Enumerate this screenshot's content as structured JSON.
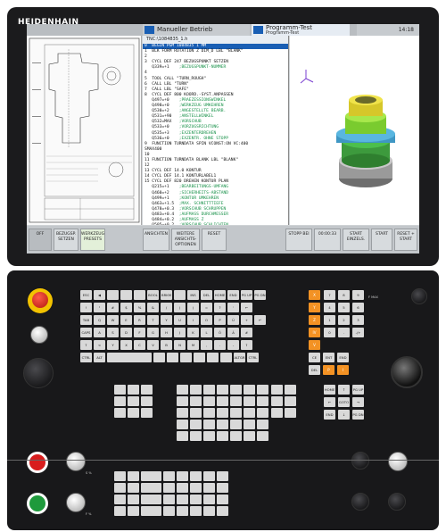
{
  "brand": {
    "logo": "HEIDENHAIN"
  },
  "screen": {
    "mode_left": "Manueller Betrieb",
    "mode_right": "Programm-Test",
    "mode_right_sub": "Programm-Test",
    "clock": "14:18",
    "program_header": "TNC:\\1084835_1.h",
    "program_lines": [
      {
        "t": "0  BEGIN PGM 1084835 1 MM",
        "sel": true
      },
      {
        "t": "1  BLK FORM ROTATION Z DIM_D LBL \"BLANK\""
      },
      {
        "t": "2"
      },
      {
        "t": "3  CYCL DEF 247 BEZUGSPUNKT SETZEN"
      },
      {
        "t": "   Q339=+1    ;BEZUGSPUNKT-NUMMER"
      },
      {
        "t": "4"
      },
      {
        "t": "5  TOOL CALL \"TURN_ROUGH\""
      },
      {
        "t": "6  CALL LBL \"TURN\""
      },
      {
        "t": "7  CALL LBL \"SAFE\""
      },
      {
        "t": "8  CYCL DEF 800 KOORD.-SYST.ANPASSEN"
      },
      {
        "t": "   Q497=+0    ;PRAEZESSIONSWINKEL"
      },
      {
        "t": "   Q498=+0    ;WERKZEUG UMKEHREN"
      },
      {
        "t": "   Q530=+2    ;ANGESTELLTE BEARB."
      },
      {
        "t": "   Q531=+90   ;ANSTELLWINKEL"
      },
      {
        "t": "   Q532=MAX   ;VORSCHUB"
      },
      {
        "t": "   Q533=+0    ;VORZUGSRICHTUNG"
      },
      {
        "t": "   Q535=+3    ;EXZENTERDREHEN"
      },
      {
        "t": "   Q536=+0    ;EXZENTR. OHNE STOPP"
      },
      {
        "t": "9  FUNCTION TURNDATA SPIN VCONST:ON VC:400"
      },
      {
        "t": "SMAX400"
      },
      {
        "t": "10"
      },
      {
        "t": "11 FUNCTION TURNDATA BLANK LBL \"BLANK\""
      },
      {
        "t": "12"
      },
      {
        "t": "13 CYCL DEF 14.0 KONTUR"
      },
      {
        "t": "14 CYCL DEF 14.1 KONTURLABEL1"
      },
      {
        "t": "15 CYCL DEF 820 DREHEN KONTUR PLAN"
      },
      {
        "t": "   Q215=+1    ;BEARBEITUNGS-UMFANG"
      },
      {
        "t": "   Q460=+2    ;SICHERHEITS-ABSTAND"
      },
      {
        "t": "   Q499=+1    ;KONTUR UMKEHREN"
      },
      {
        "t": "   Q463=+1.5  ;MAX. SCHNITTTIEFE"
      },
      {
        "t": "   Q478=+0.3  ;VORSCHUB SCHRUPPEN"
      },
      {
        "t": "   Q483=+0.4  ;AUFMASS DURCHMESSER"
      },
      {
        "t": "   Q484=+0.2  ;AUFMASS Z"
      },
      {
        "t": "   Q505=+0.2  ;VORSCHUB SCHLICHTEN"
      }
    ],
    "softkeys": [
      {
        "label": "OFF"
      },
      {
        "label": "BEZUGSP. SETZEN"
      },
      {
        "label": "WERKZEUG PRESETS"
      },
      {
        "label": "ANSICHTEN"
      },
      {
        "label": "WEITERE ANSICHTS-OPTIONEN"
      },
      {
        "label": "RESET"
      },
      {
        "label": "STOPP BEI"
      },
      {
        "label": "00:00:33"
      },
      {
        "label": "START EINZELS."
      },
      {
        "label": "START"
      },
      {
        "label": "RESET + START"
      }
    ]
  },
  "keyboard": {
    "row1": [
      "ESC",
      "◀",
      "",
      "",
      "",
      "BOOL",
      "BRKM",
      "",
      "INS",
      "DEL",
      "HOME",
      "END",
      "PG UP",
      "PG DN"
    ],
    "row2": [
      "!",
      "\"",
      "#",
      "$",
      "%",
      "&",
      "/",
      "(",
      ")",
      "=",
      "?",
      "'",
      "←"
    ],
    "row3": [
      "TAB",
      "Q",
      "W",
      "E",
      "R",
      "T",
      "Y",
      "U",
      "I",
      "O",
      "P",
      "Ü",
      "+",
      "↵"
    ],
    "row4": [
      "CAPS",
      "A",
      "S",
      "D",
      "F",
      "G",
      "H",
      "J",
      "K",
      "L",
      "Ö",
      "Ä",
      "#"
    ],
    "row5": [
      "⇧",
      "<",
      "Y",
      "X",
      "C",
      "V",
      "B",
      "N",
      "M",
      ",",
      ".",
      "-",
      "⇧"
    ],
    "row6": [
      "CTRL",
      "ALT",
      "",
      "",
      "",
      "",
      "",
      "",
      "",
      "ALTGR",
      "CTRL"
    ],
    "numpad": [
      "7",
      "8",
      "9",
      "4",
      "5",
      "6",
      "1",
      "2",
      "3",
      "0",
      ".",
      "-/+"
    ],
    "axis_keys": [
      "X",
      "Y",
      "Z",
      "IV",
      "V"
    ],
    "right_keys": [
      "CE",
      "ENT",
      "END",
      "DEL",
      "P",
      "I"
    ],
    "nav_keys": [
      "HOME",
      "↑",
      "PG UP",
      "←",
      "GOTO",
      "→",
      "END",
      "↓",
      "PG DN"
    ],
    "feed_label": "F MAX",
    "spindle_label": "S %",
    "feed_pct_label": "F %"
  }
}
